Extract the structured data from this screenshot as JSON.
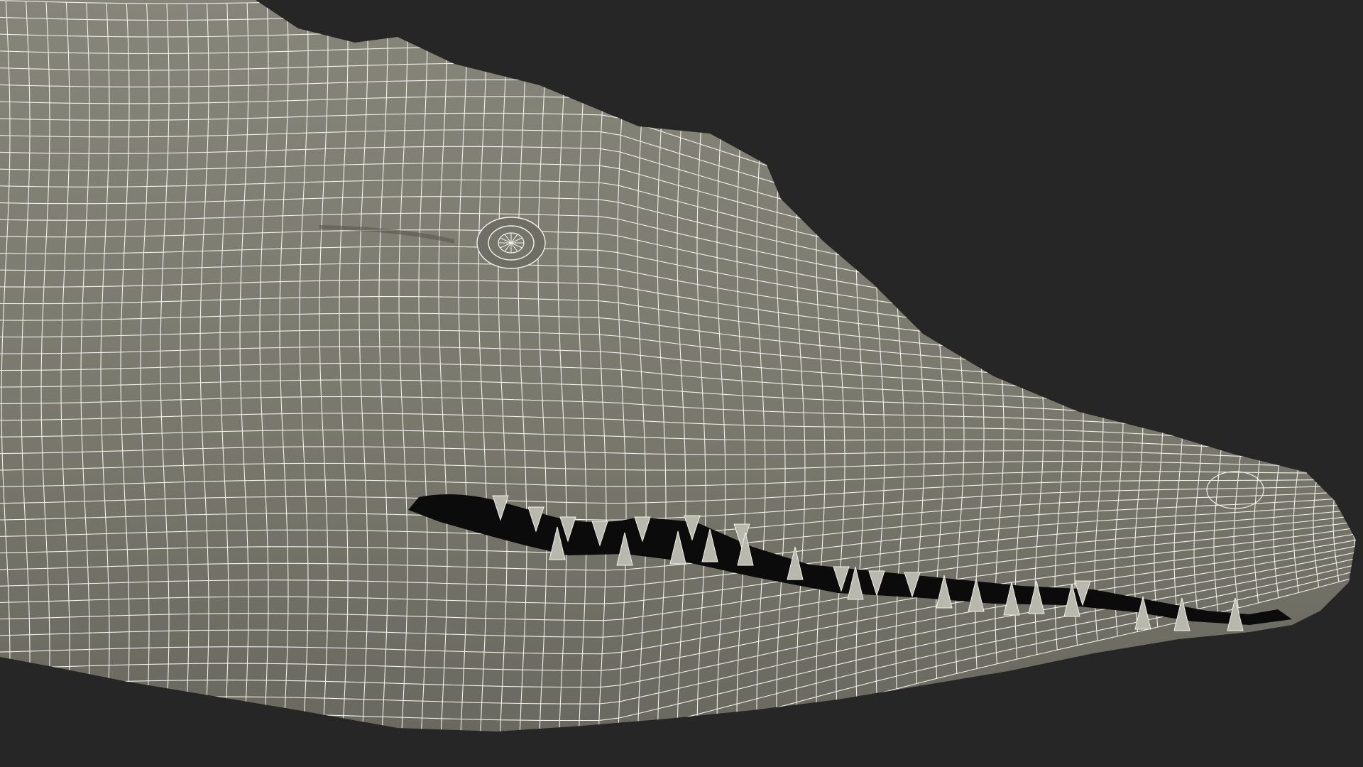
{
  "scene": {
    "subject": "crocodile-head-wireframe-render",
    "background_color": "#262626",
    "surface_color": "#7d7c70",
    "surface_shadow_color": "#5e5d54",
    "wire_color": "#f2f2ec",
    "mouth_color": "#0b0b0b",
    "tooth_color": "#b9b8ad"
  }
}
